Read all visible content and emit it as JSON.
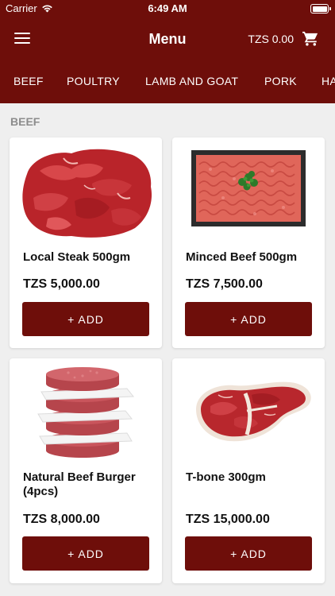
{
  "status_bar": {
    "carrier": "Carrier",
    "time": "6:49 AM"
  },
  "header": {
    "title": "Menu",
    "cart_total": "TZS 0.00",
    "menu_icon": "hamburger-icon",
    "cart_icon": "cart-icon"
  },
  "categories": [
    "BEEF",
    "POULTRY",
    "LAMB AND GOAT",
    "PORK",
    "HA"
  ],
  "section": {
    "title": "BEEF"
  },
  "products": [
    {
      "name": "Local Steak 500gm",
      "price": "TZS 5,000.00",
      "add_label": "+ ADD"
    },
    {
      "name": "Minced Beef 500gm",
      "price": "TZS 7,500.00",
      "add_label": "+ ADD"
    },
    {
      "name": "Natural Beef Burger (4pcs)",
      "price": "TZS 8,000.00",
      "add_label": "+ ADD"
    },
    {
      "name": "T-bone 300gm",
      "price": "TZS 15,000.00",
      "add_label": "+ ADD"
    }
  ],
  "colors": {
    "brand": "#6e0e0a",
    "background": "#efefef",
    "section_title": "#8c8c8c"
  }
}
